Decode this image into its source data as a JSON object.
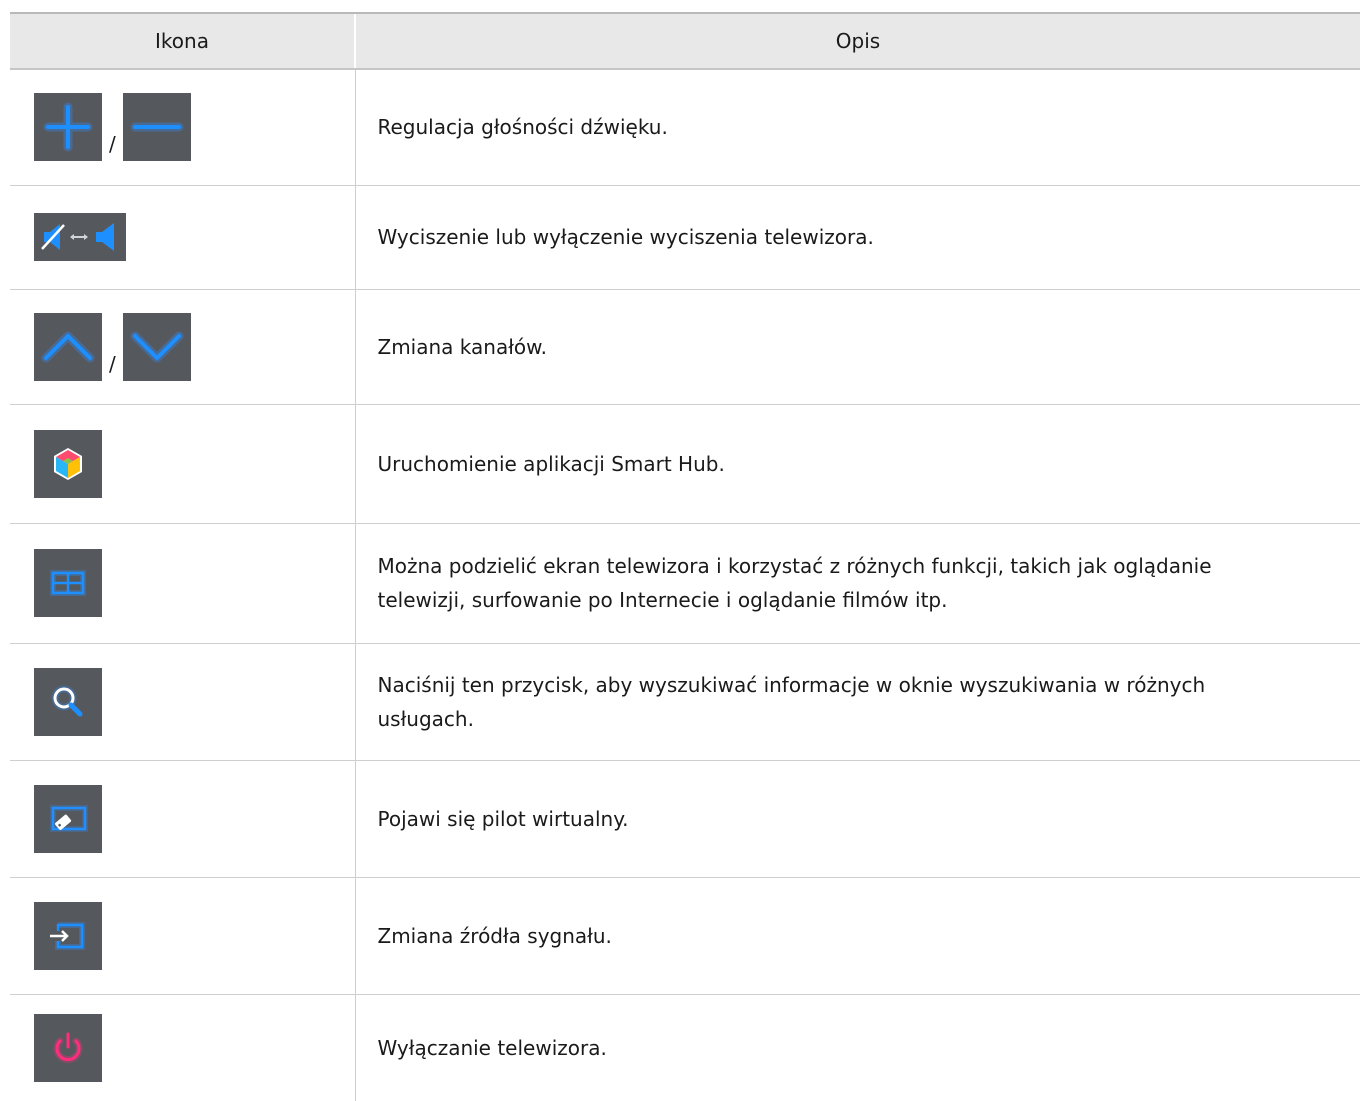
{
  "table": {
    "headers": {
      "icon": "Ikona",
      "description": "Opis"
    },
    "rows": [
      {
        "icons": [
          "plus-icon",
          "minus-icon"
        ],
        "separator": "/",
        "description": "Regulacja głośności dźwięku."
      },
      {
        "icons": [
          "mute-toggle-icon"
        ],
        "description": "Wyciszenie lub wyłączenie wyciszenia telewizora."
      },
      {
        "icons": [
          "chevron-up-icon",
          "chevron-down-icon"
        ],
        "separator": "/",
        "description": "Zmiana kanałów."
      },
      {
        "icons": [
          "smart-hub-icon"
        ],
        "description": "Uruchomienie aplikacji Smart Hub."
      },
      {
        "icons": [
          "split-screen-icon"
        ],
        "description": "Można podzielić ekran telewizora i korzystać z różnych funkcji, takich jak oglądanie telewizji, surfowanie po Internecie i oglądanie filmów itp."
      },
      {
        "icons": [
          "search-icon"
        ],
        "description": "Naciśnij ten przycisk, aby wyszukiwać informacje w oknie wyszukiwania w różnych usługach."
      },
      {
        "icons": [
          "virtual-remote-icon"
        ],
        "description": "Pojawi się pilot wirtualny."
      },
      {
        "icons": [
          "source-icon"
        ],
        "description": "Zmiana źródła sygnału."
      },
      {
        "icons": [
          "power-icon"
        ],
        "description": "Wyłączanie telewizora."
      }
    ]
  },
  "colors": {
    "button_bg": "#55595e",
    "icon_blue": "#1e8fff",
    "icon_glow": "#2f8cff",
    "power_pink": "#ff2d7d",
    "header_bg": "#e8e8e8"
  }
}
